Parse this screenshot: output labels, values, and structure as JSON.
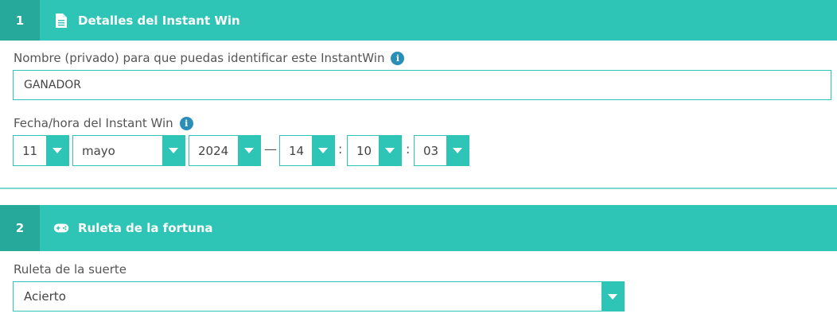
{
  "section1": {
    "number": "1",
    "title": "Detalles del Instant Win",
    "icon": "document-icon"
  },
  "name_field": {
    "label": "Nombre (privado) para que puedas identificar este InstantWin",
    "value": "GANADOR",
    "info_icon": "info-icon"
  },
  "datetime": {
    "label": "Fecha/hora del Instant Win",
    "day": "11",
    "month": "mayo",
    "year": "2024",
    "dash": "—",
    "hour": "14",
    "colon1": ":",
    "minute": "10",
    "colon2": ":",
    "second": "03"
  },
  "section2": {
    "number": "2",
    "title": "Ruleta de la fortuna",
    "icon": "gamepad-icon"
  },
  "wheel": {
    "label": "Ruleta de la suerte",
    "value": "Acierto"
  },
  "colors": {
    "accent": "#2ec4b6",
    "accent_dark": "#26a89b",
    "info": "#2a8fb8"
  }
}
